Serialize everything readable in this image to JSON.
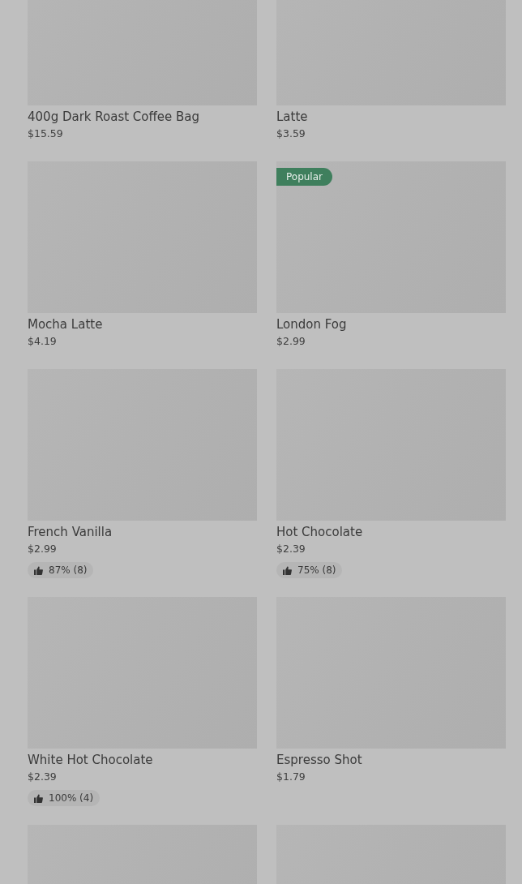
{
  "product_rows": [
    {
      "items": [
        {
          "kind": "product",
          "name": "400g Dark Roast Coffee Bag",
          "price": "$15.59"
        },
        {
          "kind": "product",
          "name": "Latte",
          "price": "$3.59"
        }
      ]
    },
    {
      "items": [
        {
          "kind": "product",
          "name": "Mocha Latte",
          "price": "$4.19"
        },
        {
          "kind": "product",
          "name": "London Fog",
          "price": "$2.99",
          "badge": "Popular"
        }
      ]
    },
    {
      "items": [
        {
          "kind": "product",
          "name": "French Vanilla",
          "price": "$2.99",
          "rating": "87% (8)"
        },
        {
          "kind": "product",
          "name": "Hot Chocolate",
          "price": "$2.39",
          "rating": "75% (8)"
        }
      ]
    },
    {
      "items": [
        {
          "kind": "product",
          "name": "White Hot Chocolate",
          "price": "$2.39",
          "rating": "100% (4)"
        },
        {
          "kind": "product",
          "name": "Espresso Shot",
          "price": "$1.79"
        }
      ]
    },
    {
      "items": [
        {
          "kind": "picture"
        },
        {
          "kind": "picture"
        }
      ]
    }
  ]
}
